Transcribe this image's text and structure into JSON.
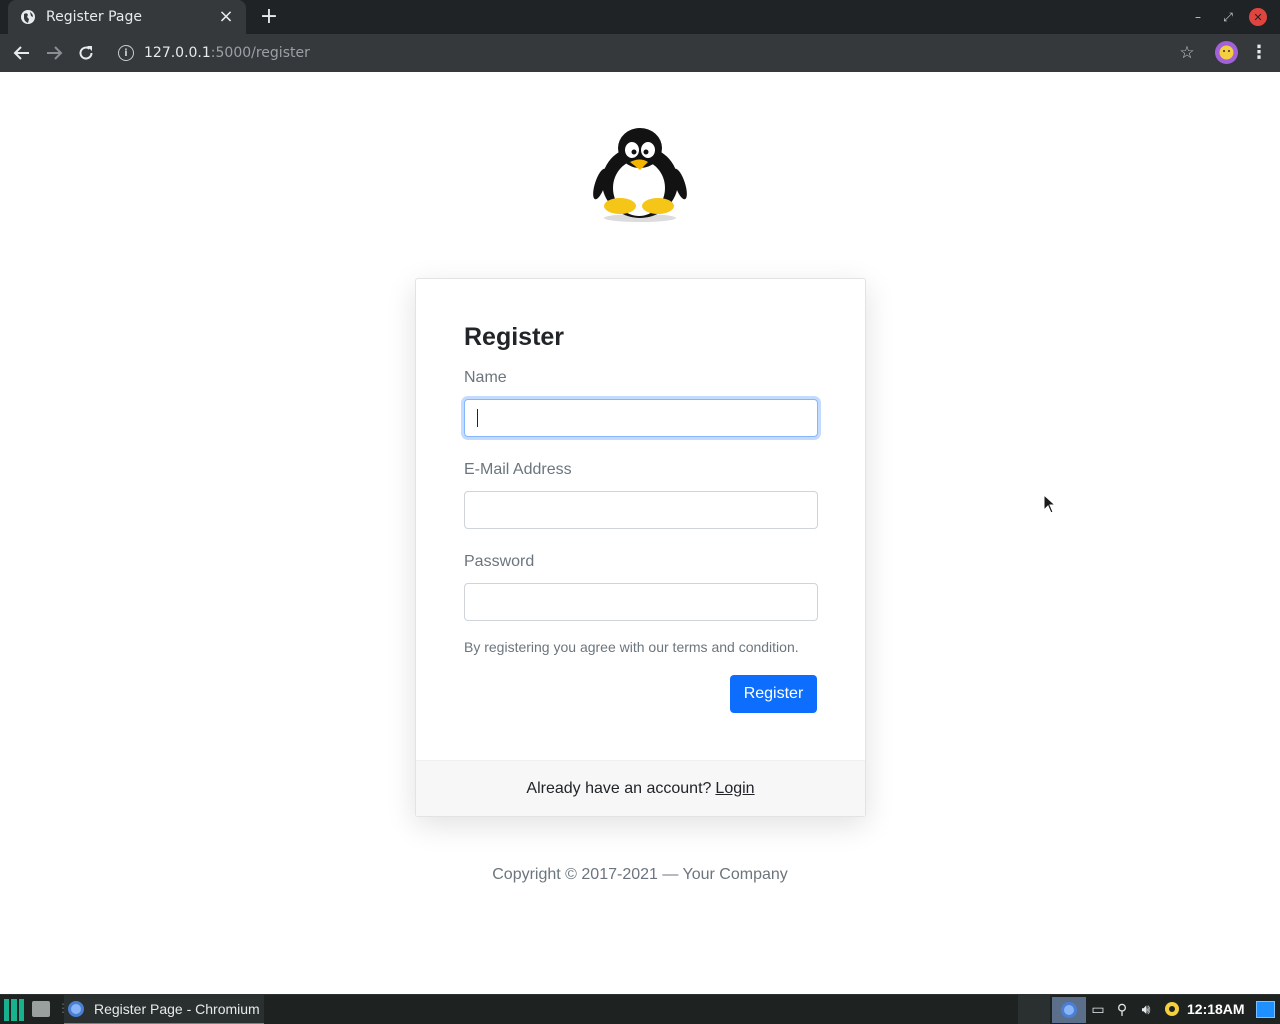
{
  "browser": {
    "tab_title": "Register Page",
    "url_host": "127.0.0.1",
    "url_path": ":5000/register"
  },
  "register": {
    "title": "Register",
    "name_label": "Name",
    "name_value": "",
    "email_label": "E-Mail Address",
    "email_value": "",
    "password_label": "Password",
    "password_value": "",
    "terms_text": "By registering you agree with our terms and condition.",
    "submit_label": "Register",
    "footer_prompt": "Already have an account?",
    "login_link": "Login"
  },
  "copyright": "Copyright © 2017-2021 — Your Company",
  "taskbar": {
    "task_label": "Register Page - Chromium",
    "clock": "12:18AM"
  },
  "colors": {
    "primary": "#0d6efd",
    "chrome_dark": "#1f2326",
    "chrome_toolbar": "#35393c",
    "taskbar_accent": "#18b28f"
  }
}
